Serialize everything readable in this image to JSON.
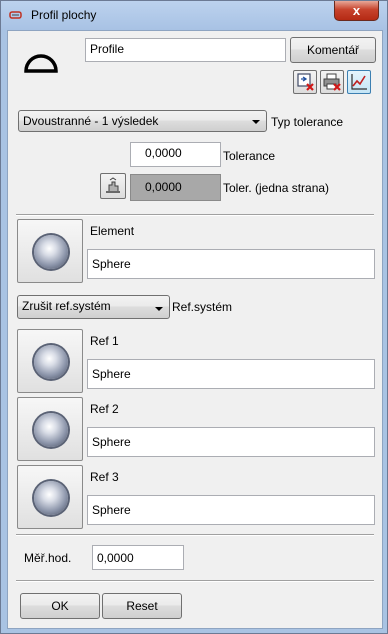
{
  "window": {
    "title": "Profil plochy",
    "close_glyph": "x"
  },
  "profile": {
    "name_value": "Profile",
    "comment_button": "Komentář"
  },
  "tolerance": {
    "type_value": "Dvoustranné - 1 výsledek",
    "type_label": "Typ tolerance",
    "tolerance_value": "0,0000",
    "tolerance_label": "Tolerance",
    "one_side_value": "0,0000",
    "one_side_label": "Toler. (jedna strana)"
  },
  "element": {
    "label": "Element",
    "value": "Sphere"
  },
  "ref_system": {
    "value": "Zrušit ref.systém",
    "label": "Ref.systém",
    "refs": [
      {
        "label": "Ref 1",
        "value": "Sphere"
      },
      {
        "label": "Ref 2",
        "value": "Sphere"
      },
      {
        "label": "Ref 3",
        "value": "Sphere"
      }
    ]
  },
  "measured": {
    "label": "Měř.hod.",
    "value": "0,0000"
  },
  "footer": {
    "ok": "OK",
    "reset": "Reset"
  },
  "icons": [
    "profile-surface-icon",
    "export-delete-icon",
    "print-delete-icon",
    "chart-icon",
    "hand-tool-icon",
    "sphere-icon"
  ]
}
